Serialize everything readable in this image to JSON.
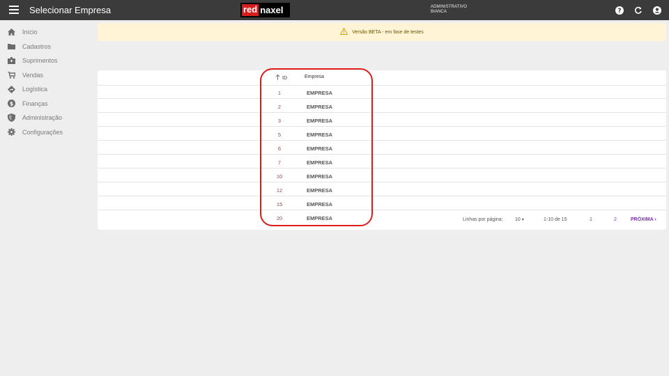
{
  "topbar": {
    "title": "Selecionar Empresa",
    "logo_red": "red",
    "logo_naxel": "naxel",
    "user_role": "ADMINISTRATIVO",
    "user_name": "BIANCA"
  },
  "sidebar": {
    "items": [
      {
        "label": "Início",
        "icon": "home-icon"
      },
      {
        "label": "Cadastros",
        "icon": "folder-icon"
      },
      {
        "label": "Suprimentos",
        "icon": "box-icon"
      },
      {
        "label": "Vendas",
        "icon": "cart-icon"
      },
      {
        "label": "Logística",
        "icon": "route-icon"
      },
      {
        "label": "Finanças",
        "icon": "dollar-icon"
      },
      {
        "label": "Administração",
        "icon": "shield-icon"
      },
      {
        "label": "Configurações",
        "icon": "gear-icon"
      }
    ]
  },
  "banner": {
    "text": "Versão BETA - em fase de testes"
  },
  "table": {
    "col_id": "ID",
    "col_empresa": "Empresa",
    "rows": [
      {
        "id": "1",
        "empresa": "EMPRESA"
      },
      {
        "id": "2",
        "empresa": "EMPRESA"
      },
      {
        "id": "3",
        "empresa": "EMPRESA"
      },
      {
        "id": "5",
        "empresa": "EMPRESA"
      },
      {
        "id": "6",
        "empresa": "EMPRESA"
      },
      {
        "id": "7",
        "empresa": "EMPRESA"
      },
      {
        "id": "10",
        "empresa": "EMPRESA"
      },
      {
        "id": "12",
        "empresa": "EMPRESA"
      },
      {
        "id": "15",
        "empresa": "EMPRESA"
      },
      {
        "id": "20",
        "empresa": "EMPRESA"
      }
    ]
  },
  "pager": {
    "rows_label": "Linhas por página:",
    "rows_value": "10",
    "range": "1-10 de 15",
    "page1": "1",
    "page2": "2",
    "next": "PRÓXIMA"
  },
  "colors": {
    "topbar": "#3b3b3b",
    "accent": "#7b2cbf",
    "highlight": "#e01b1b",
    "banner": "#fff4d6"
  }
}
